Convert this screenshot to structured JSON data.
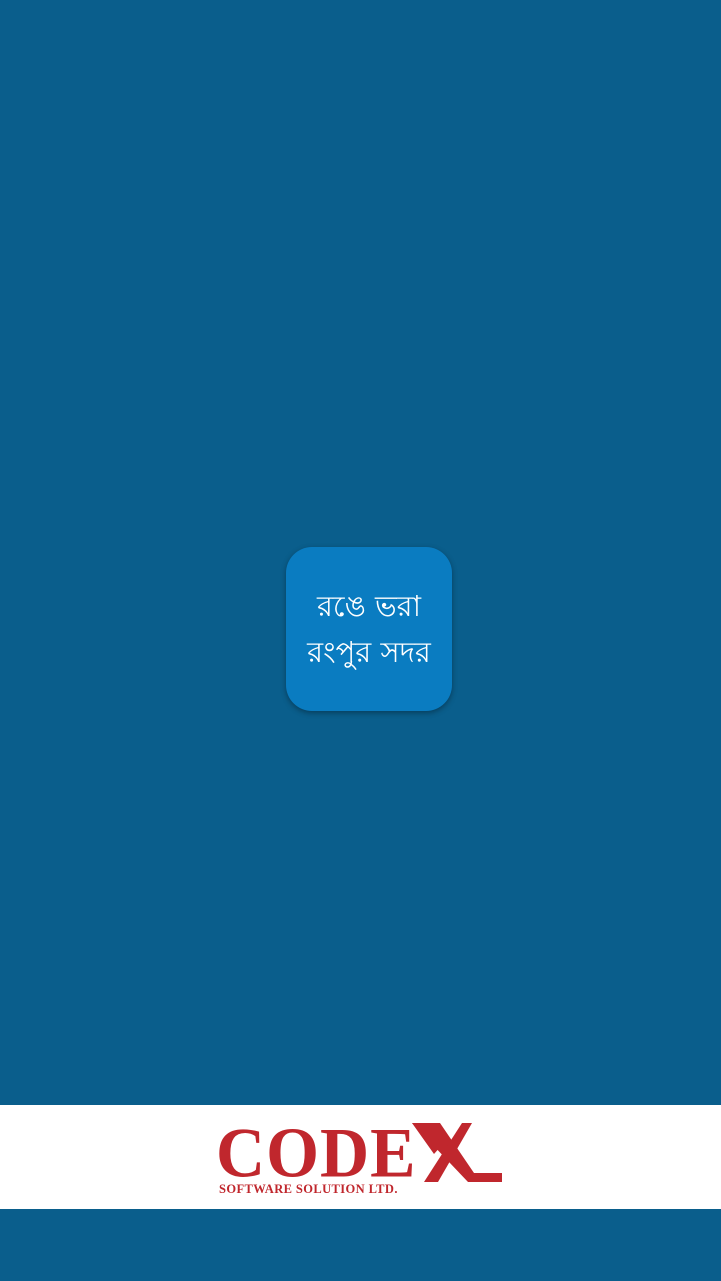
{
  "splash": {
    "app_icon": {
      "line1": "রঙে ভরা",
      "line2": "রংপুর সদর"
    }
  },
  "footer": {
    "logo": {
      "word": "CODE",
      "tagline": "SOFTWARE SOLUTION LTD."
    }
  },
  "colors": {
    "background": "#0a5e8c",
    "icon_fill": "#0a7cc1",
    "brand_red": "#c0272d",
    "footer_bg": "#ffffff"
  }
}
